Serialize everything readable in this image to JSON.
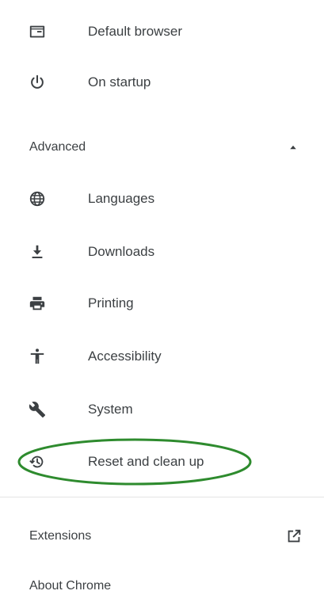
{
  "menu": {
    "items_top": [
      {
        "label": "Default browser",
        "icon": "browser-window-icon"
      },
      {
        "label": "On startup",
        "icon": "power-icon"
      }
    ],
    "advanced": {
      "label": "Advanced",
      "arrow_icon": "collapse-arrow-icon",
      "items": [
        {
          "label": "Languages",
          "icon": "globe-icon"
        },
        {
          "label": "Downloads",
          "icon": "download-icon"
        },
        {
          "label": "Printing",
          "icon": "printer-icon"
        },
        {
          "label": "Accessibility",
          "icon": "accessibility-icon"
        },
        {
          "label": "System",
          "icon": "wrench-icon"
        },
        {
          "label": "Reset and clean up",
          "icon": "restore-icon"
        }
      ]
    },
    "extensions": {
      "label": "Extensions",
      "icon": "open-in-new-icon"
    },
    "about": {
      "label": "About Chrome"
    }
  },
  "colors": {
    "text": "#3c4043",
    "highlight": "#2e8b2e",
    "divider": "#e4e4e4"
  }
}
